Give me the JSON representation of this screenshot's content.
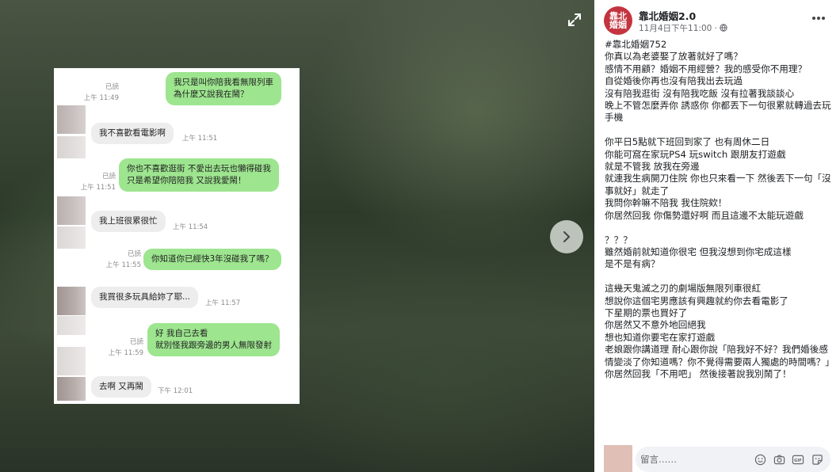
{
  "chat": {
    "messages": [
      {
        "side": "out",
        "lines": [
          "我只是叫你陪我看無限列車",
          "為什麼又說我在鬧？"
        ],
        "read": "已読",
        "time": "上午 11:49"
      },
      {
        "side": "in",
        "lines": [
          "我不喜歡看電影啊"
        ],
        "time": "上午 11:51"
      },
      {
        "side": "out",
        "lines": [
          "你也不喜歡逛街 不愛出去玩也懶得碰我",
          "只是希望你陪陪我 又說我愛鬧！"
        ],
        "read": "已読",
        "time": "上午 11:51"
      },
      {
        "side": "in",
        "lines": [
          "我上班很累很忙"
        ],
        "time": "上午 11:54"
      },
      {
        "side": "out",
        "lines": [
          "你知道你已經快3年沒碰我了嗎？"
        ],
        "read": "已読",
        "time": "上午 11:55"
      },
      {
        "side": "in",
        "lines": [
          "我買很多玩具給妳了耶..."
        ],
        "time": "上午 11:57"
      },
      {
        "side": "out",
        "lines": [
          "好 我自己去看",
          "就別怪我跟旁邊的男人無限發射"
        ],
        "read": "已読",
        "time": "上午 11:59"
      },
      {
        "side": "in",
        "lines": [
          "去啊 又再鬧"
        ],
        "time": "下午 12:01"
      }
    ]
  },
  "viewer": {
    "expand_icon": "expand-arrows-icon",
    "next_icon": "chevron-right-icon"
  },
  "post": {
    "page_avatar_text": "靠北婚姻",
    "page_name": "靠北婚姻2.0",
    "timestamp": "11月4日下午11:00 · ",
    "privacy_icon": "globe-icon",
    "more_icon": "more-dots-icon",
    "body": "#靠北婚姻752\n你真以為老婆娶了放著就好了嗎？\n感情不用顧？婚姻不用經營？我的感受你不用理？\n自從婚後你再也沒有陪我出去玩過\n沒有陪我逛街 沒有陪我吃飯 沒有拉著我談談心\n晚上不管怎麼弄你 誘惑你 你都丟下一句很累就轉過去玩手機\n\n你平日5點就下班回到家了 也有周休二日\n你能可窩在家玩PS4 玩switch 跟朋友打遊戲\n就是不管我 放我在旁邊\n就連我生病開刀住院 你也只來看一下 然後丟下一句「沒事就好」就走了\n我問你幹嘛不陪我 我住院欸！\n你居然回我 你傷勢還好啊 而且這邊不太能玩遊戲\n\n？？？\n雖然婚前就知道你很宅 但我沒想到你宅成這樣\n是不是有病？\n\n這幾天鬼滅之刃的劇場版無限列車很紅\n想說你這個宅男應該有興趣就約你去看電影了\n下星期的票也買好了\n你居然又不意外地回絕我\n想也知道你要宅在家打遊戲\n老娘跟你講道理 耐心跟你說「陪我好不好？我們婚後感情變淡了你知道嗎？你不覺得需要兩人獨處的時間嗎？」\n你居然回我「不用吧」 然後接著說我別鬧了！"
  },
  "comment": {
    "placeholder": "留言……",
    "icons": [
      "emoji-icon",
      "camera-icon",
      "gif-icon",
      "sticker-icon"
    ]
  },
  "colors": {
    "outgoing_bubble": "#9de58f",
    "incoming_bubble": "#ededed",
    "page_avatar": "#c3343f"
  }
}
